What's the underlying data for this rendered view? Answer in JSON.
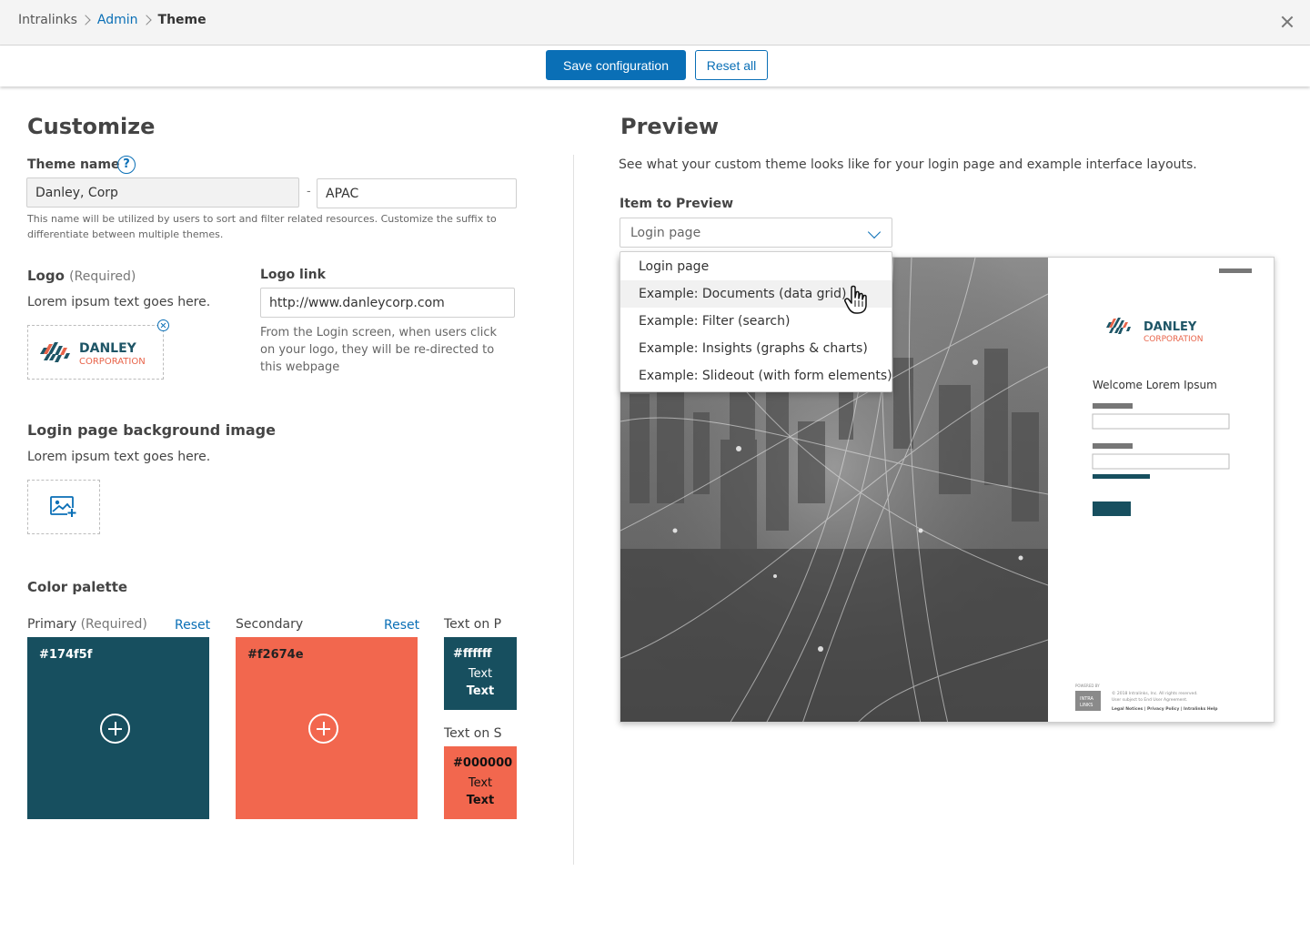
{
  "breadcrumb": {
    "root": "Intralinks",
    "admin": "Admin",
    "current": "Theme"
  },
  "actions": {
    "save_label": "Save configuration",
    "reset_label": "Reset all"
  },
  "customize": {
    "title": "Customize",
    "theme_name": {
      "label": "Theme name",
      "help": "?",
      "value": "Danley, Corp",
      "separator": "-",
      "suffix_value": "APAC",
      "hint": "This name will be utilized by users to sort and filter related resources. Customize the suffix to differentiate between multiple themes."
    },
    "logo": {
      "label": "Logo",
      "required": "(Required)",
      "desc": "Lorem ipsum text goes here.",
      "brand_main": "DANLEY",
      "brand_sub": "CORPORATION"
    },
    "logo_link": {
      "label": "Logo link",
      "value": "http://www.danleycorp.com",
      "hint": "From the Login screen, when users click on your logo, they will be re-directed to this webpage"
    },
    "background": {
      "label": "Login page background image",
      "desc": "Lorem ipsum text goes here."
    },
    "palette": {
      "label": "Color palette",
      "primary": {
        "label": "Primary",
        "required": "(Required)",
        "reset": "Reset",
        "hex": "#174f5f"
      },
      "secondary": {
        "label": "Secondary",
        "reset": "Reset",
        "hex": "#f2674e"
      },
      "text_on_primary": {
        "label": "Text on P",
        "hex": "#ffffff",
        "t1": "Text",
        "t2": "Text"
      },
      "text_on_secondary": {
        "label": "Text on S",
        "hex": "#000000",
        "t1": "Text",
        "t2": "Text"
      }
    }
  },
  "preview": {
    "title": "Preview",
    "desc": "See what your custom theme looks like for your login page and example interface layouts.",
    "item_label": "Item to Preview",
    "selected": "Login page",
    "options": [
      "Login page",
      "Example: Documents (data grid)",
      "Example: Filter (search)",
      "Example: Insights (graphs & charts)",
      "Example: Slideout (with form elements)"
    ],
    "login": {
      "brand_main": "DANLEY",
      "brand_sub": "CORPORATION",
      "welcome": "Welcome Lorem Ipsum",
      "powered": "POWERED BY",
      "badge_top": "INTRA",
      "badge_bottom": "LINKS",
      "copyright": "© 2018 Intralinks, Inc. All rights reserved.",
      "agreement": "User subject to End User Agreement.",
      "links": "Legal Notices  |  Privacy Policy  |  Intralinks Help"
    }
  },
  "colors": {
    "accent": "#0a6fb6",
    "primary": "#174f5f",
    "secondary": "#f2674e"
  }
}
